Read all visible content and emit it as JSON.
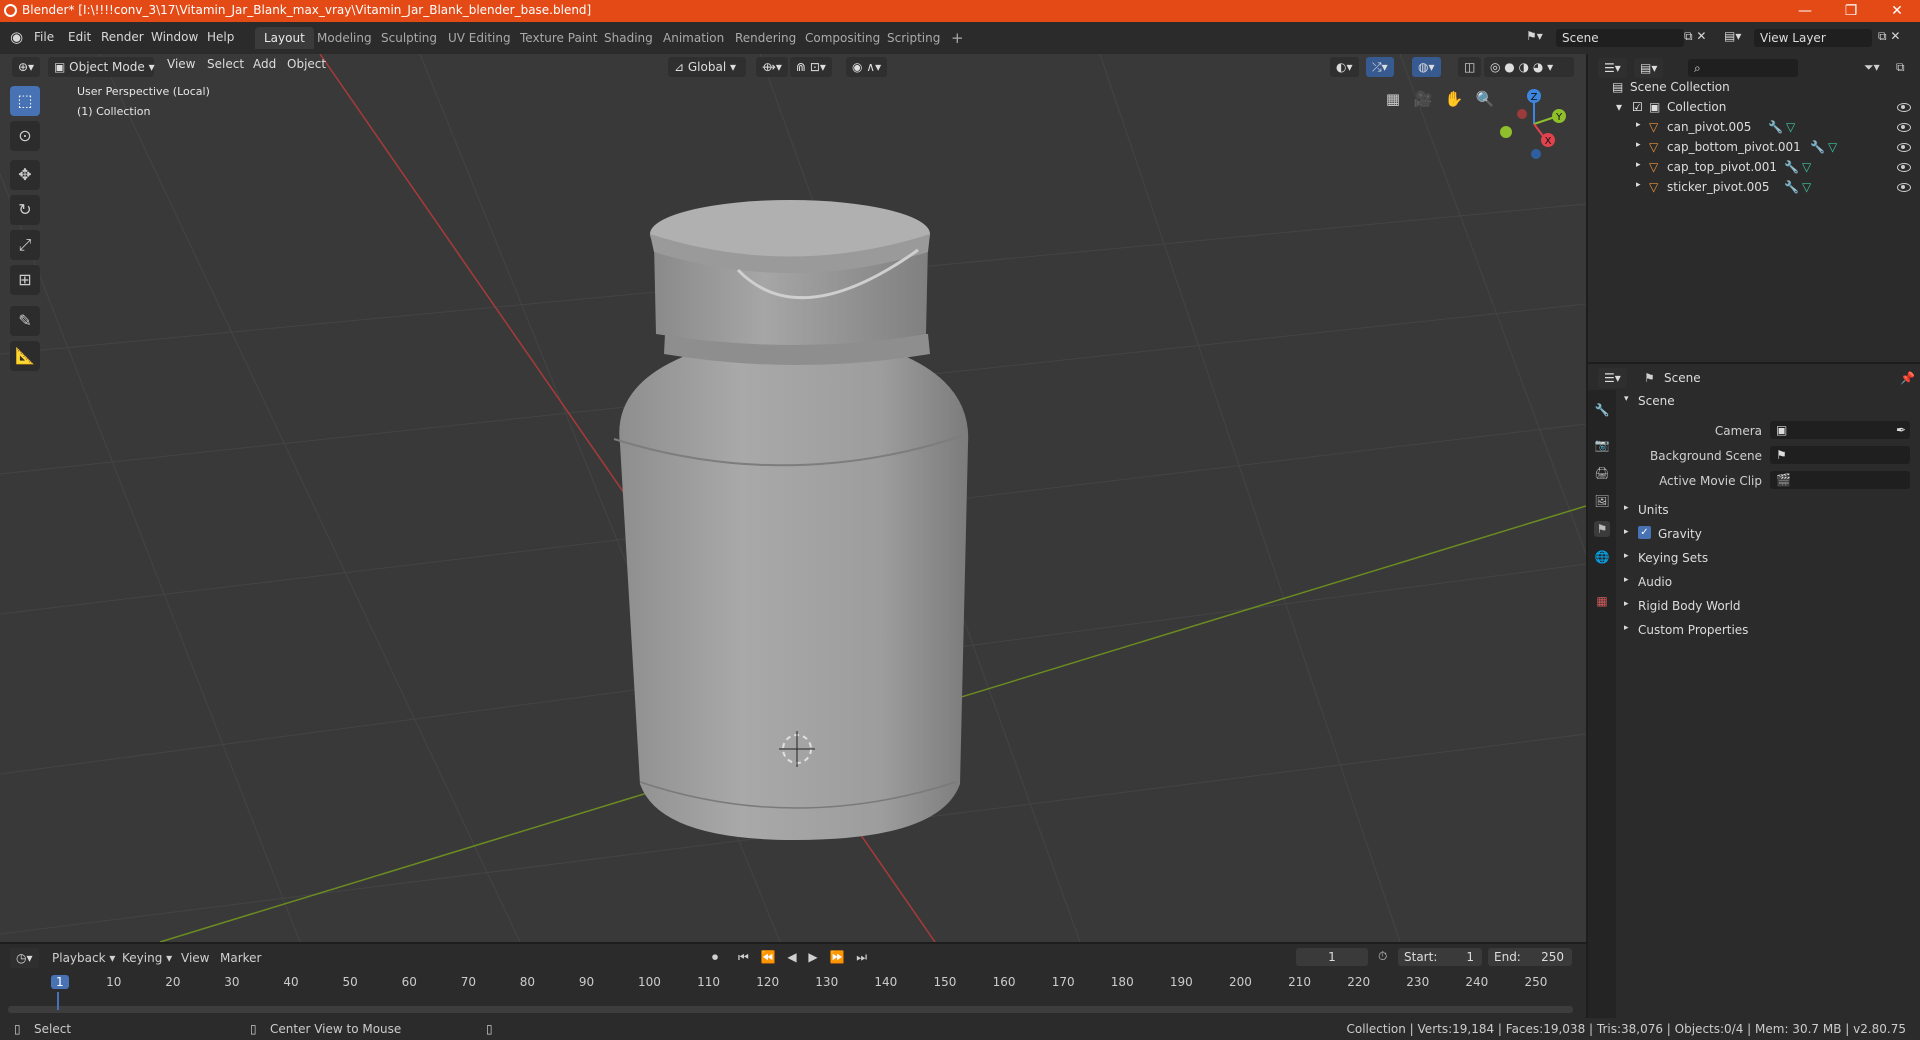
{
  "titlebar": {
    "title": "Blender* [I:\\!!!!conv_3\\17\\Vitamin_Jar_Blank_max_vray\\Vitamin_Jar_Blank_blender_base.blend]",
    "minimize": "—",
    "maximize": "❐",
    "close": "✕"
  },
  "menubar": {
    "menus": [
      "File",
      "Edit",
      "Render",
      "Window",
      "Help"
    ],
    "workspaces": [
      "Layout",
      "Modeling",
      "Sculpting",
      "UV Editing",
      "Texture Paint",
      "Shading",
      "Animation",
      "Rendering",
      "Compositing",
      "Scripting"
    ],
    "add_workspace": "+",
    "scene_field": "Scene",
    "view_layer_field": "View Layer"
  },
  "viewport": {
    "mode": "Object Mode",
    "menus": [
      "View",
      "Select",
      "Add",
      "Object"
    ],
    "transform_orientation": "Global",
    "overlay_text_1": "User Perspective (Local)",
    "overlay_text_2": "(1) Collection",
    "gizmo": {
      "z": "Z",
      "y": "Y",
      "x": "X"
    }
  },
  "outliner": {
    "search_placeholder": "",
    "scene_collection": "Scene Collection",
    "collection": "Collection",
    "objects": [
      "can_pivot.005",
      "cap_bottom_pivot.001",
      "cap_top_pivot.001",
      "sticker_pivot.005"
    ]
  },
  "properties": {
    "context": "Scene",
    "panel_title": "Scene",
    "fields": [
      {
        "label": "Camera",
        "value": ""
      },
      {
        "label": "Background Scene",
        "value": ""
      },
      {
        "label": "Active Movie Clip",
        "value": ""
      }
    ],
    "sections": [
      "Units",
      "Gravity",
      "Keying Sets",
      "Audio",
      "Rigid Body World",
      "Custom Properties"
    ],
    "gravity_checked": true
  },
  "timeline": {
    "menus": [
      "Playback",
      "Keying",
      "View",
      "Marker"
    ],
    "current_frame": "1",
    "start_label": "Start:",
    "start_value": "1",
    "end_label": "End:",
    "end_value": "250",
    "ticks": [
      "1",
      "10",
      "20",
      "30",
      "40",
      "50",
      "60",
      "70",
      "80",
      "90",
      "100",
      "110",
      "120",
      "130",
      "140",
      "150",
      "160",
      "170",
      "180",
      "190",
      "200",
      "210",
      "220",
      "230",
      "240",
      "250"
    ]
  },
  "status": {
    "left_action": "Select",
    "middle_action": "Center View to Mouse",
    "stats": "Collection | Verts:19,184 | Faces:19,038 | Tris:38,076 | Objects:0/4 | Mem: 30.7 MB | v2.80.75"
  },
  "colors": {
    "titlebar": "#e34a16",
    "accent": "#4772b3",
    "x_axis": "#a83a3a",
    "y_axis": "#6b8c21",
    "gizmo_x": "#e0434d",
    "gizmo_y": "#8fbf2a",
    "gizmo_z": "#3d86e0"
  }
}
